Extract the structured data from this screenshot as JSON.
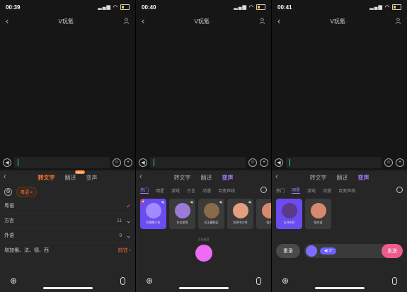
{
  "panels": [
    {
      "status": {
        "time": "00:39"
      }
    },
    {
      "status": {
        "time": "00:40"
      }
    },
    {
      "status": {
        "time": "00:41"
      }
    }
  ],
  "chat": {
    "title": "V玩氪",
    "back": "<"
  },
  "tabs": {
    "to_text": "转文字",
    "translate": "翻译",
    "voice_change": "变声",
    "new_badge": "NEW"
  },
  "panel1": {
    "chip": "粤语",
    "items": [
      {
        "label": "粤语",
        "value": "",
        "mark": "✓"
      },
      {
        "label": "方言",
        "value": "11",
        "mark": "⌄"
      },
      {
        "label": "外语",
        "value": "9",
        "mark": "⌄"
      },
      {
        "label": "增加俄、法、德、西",
        "value": "",
        "mark": "前往 ›"
      }
    ]
  },
  "panel2": {
    "categories": [
      "热门",
      "明星",
      "游戏",
      "方言",
      "动漫",
      "百变声线"
    ],
    "voices": [
      "奶糯糯小兔",
      "东北老哥",
      "巴王霸照迈",
      "机译书大师",
      "怪鸟"
    ],
    "hint": "点击录音"
  },
  "panel3": {
    "categories": [
      "热门",
      "明星",
      "游戏",
      "动漫",
      "百变声线"
    ],
    "voices": [
      "吉林杰邦",
      "怪鸟说"
    ],
    "reset": "重录",
    "duration": "3\"",
    "send": "发送"
  },
  "colors": {
    "orange": "#ff7a2f",
    "purple": "#a97cff",
    "pink": "#ee6bf5",
    "send": "#ee5b8d"
  }
}
